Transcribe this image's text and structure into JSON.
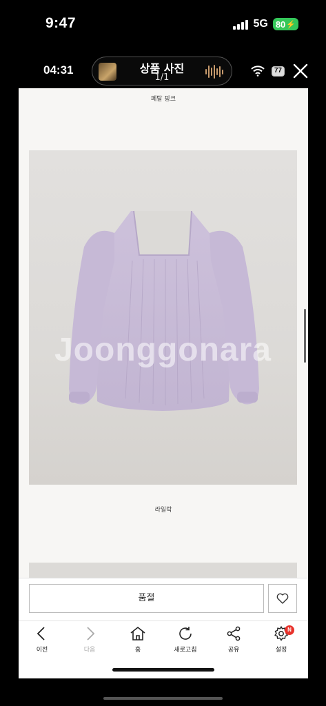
{
  "status_bar": {
    "time": "9:47",
    "network": "5G",
    "battery": "80"
  },
  "overlay": {
    "time": "04:31",
    "title": "상품 사진",
    "counter": "1/1",
    "battery": "77"
  },
  "product": {
    "caption_top": "페탈 핑크",
    "caption_bottom": "라일락",
    "watermark": "Joonggonara"
  },
  "buy_bar": {
    "soldout_label": "품절"
  },
  "nav": {
    "items": [
      {
        "label": "이전",
        "icon": "chevron-left-icon"
      },
      {
        "label": "다음",
        "icon": "chevron-right-icon"
      },
      {
        "label": "홈",
        "icon": "home-icon"
      },
      {
        "label": "새로고침",
        "icon": "refresh-icon"
      },
      {
        "label": "공유",
        "icon": "share-icon"
      },
      {
        "label": "설정",
        "icon": "gear-icon",
        "badge": "N"
      }
    ]
  },
  "colors": {
    "accent_badge": "#e8322b",
    "battery_green": "#34c759",
    "blouse": "#c9bcd8"
  }
}
